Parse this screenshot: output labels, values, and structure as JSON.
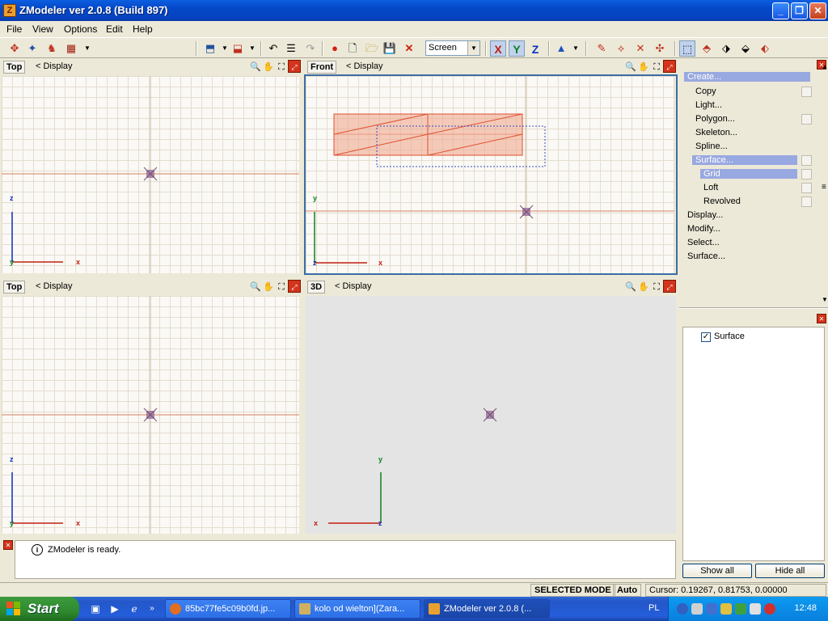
{
  "window": {
    "title": "ZModeler ver 2.0.8 (Build 897)",
    "app_icon": "Z",
    "buttons": {
      "minimize": "_",
      "maximize": "❐",
      "close": "✕"
    }
  },
  "menu": [
    "File",
    "View",
    "Options",
    "Edit",
    "Help"
  ],
  "toolbar": {
    "view_mode": "Screen",
    "axes": [
      "X",
      "Y",
      "Z"
    ]
  },
  "viewports": {
    "top_left": {
      "name": "Top",
      "display": "< Display",
      "axis_v": "z",
      "axis_h": "x",
      "origin": "y"
    },
    "top_right": {
      "name": "Front",
      "display": "< Display",
      "axis_v": "y",
      "axis_h": "x",
      "origin": "z"
    },
    "bottom_left": {
      "name": "Top",
      "display": "< Display",
      "axis_v": "z",
      "axis_h": "x",
      "origin": "y"
    },
    "bottom_right": {
      "name": "3D",
      "display": "< Display",
      "axis_v": "y",
      "axis_h": "x",
      "origin": "z"
    }
  },
  "panel": {
    "tree": [
      {
        "label": "Create...",
        "indent": 0,
        "highlight": true,
        "box": false
      },
      {
        "label": "Copy",
        "indent": 1,
        "highlight": false,
        "box": true
      },
      {
        "label": "Light...",
        "indent": 1,
        "highlight": false,
        "box": false
      },
      {
        "label": "Polygon...",
        "indent": 1,
        "highlight": false,
        "box": true
      },
      {
        "label": "Skeleton...",
        "indent": 1,
        "highlight": false,
        "box": false
      },
      {
        "label": "Spline...",
        "indent": 1,
        "highlight": false,
        "box": false
      },
      {
        "label": "Surface...",
        "indent": 1,
        "highlight": true,
        "box": true
      },
      {
        "label": "Grid",
        "indent": 2,
        "highlight": true,
        "box": true
      },
      {
        "label": "Loft",
        "indent": 2,
        "highlight": false,
        "box": true
      },
      {
        "label": "Revolved",
        "indent": 2,
        "highlight": false,
        "box": true
      },
      {
        "label": "Display...",
        "indent": 0,
        "highlight": false,
        "box": false
      },
      {
        "label": "Modify...",
        "indent": 0,
        "highlight": false,
        "box": false
      },
      {
        "label": "Select...",
        "indent": 0,
        "highlight": false,
        "box": false
      },
      {
        "label": "Surface...",
        "indent": 0,
        "highlight": false,
        "box": false
      }
    ],
    "surface_item": "Surface",
    "show_all": "Show all",
    "hide_all": "Hide all"
  },
  "log": {
    "message": "ZModeler is ready.",
    "icon": "i"
  },
  "status": {
    "mode": "SELECTED MODE",
    "snap": "Auto",
    "cursor": "Cursor: 0.19267, 0.81753, 0.00000"
  },
  "taskbar": {
    "start": "Start",
    "tasks": [
      {
        "label": "85bc77fe5c09b0fd.jp...",
        "active": false
      },
      {
        "label": "kolo od wielton](Zara...",
        "active": false
      },
      {
        "label": "ZModeler ver 2.0.8 (...",
        "active": true
      }
    ],
    "language": "PL",
    "clock": "12:48"
  }
}
